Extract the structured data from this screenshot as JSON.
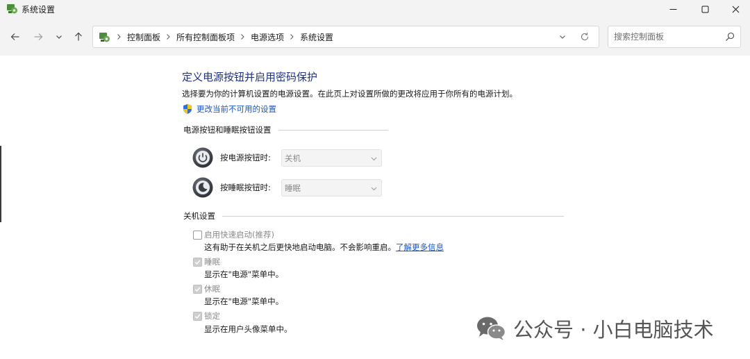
{
  "window": {
    "title": "系统设置",
    "icon": "control-panel-icon"
  },
  "address": {
    "crumbs": [
      "控制面板",
      "所有控制面板项",
      "电源选项",
      "系统设置"
    ]
  },
  "search": {
    "placeholder": "搜索控制面板"
  },
  "page": {
    "title": "定义电源按钮并启用密码保护",
    "description": "选择要为你的计算机设置的电源设置。在此页上对设置所做的更改将应用于你所有的电源计划。",
    "change_link": "更改当前不可用的设置"
  },
  "power_section": {
    "header": "电源按钮和睡眠按钮设置",
    "rows": [
      {
        "label": "按电源按钮时:",
        "value": "关机"
      },
      {
        "label": "按睡眠按钮时:",
        "value": "睡眠"
      }
    ]
  },
  "shutdown_section": {
    "header": "关机设置",
    "items": [
      {
        "label": "启用快速启动(推荐)",
        "checked": false,
        "description": "这有助于在关机之后更快地启动电脑。不会影响重启。",
        "link": "了解更多信息"
      },
      {
        "label": "睡眠",
        "checked": true,
        "description": "显示在\"电源\"菜单中。"
      },
      {
        "label": "休眠",
        "checked": true,
        "description": "显示在\"电源\"菜单中。"
      },
      {
        "label": "锁定",
        "checked": true,
        "description": "显示在用户头像菜单中。"
      }
    ]
  },
  "watermark": {
    "text": "公众号 · 小白电脑技术"
  },
  "colors": {
    "title_blue": "#1e3287",
    "link_blue": "#1a56c4",
    "chrome_bg": "#f3f3f3"
  }
}
